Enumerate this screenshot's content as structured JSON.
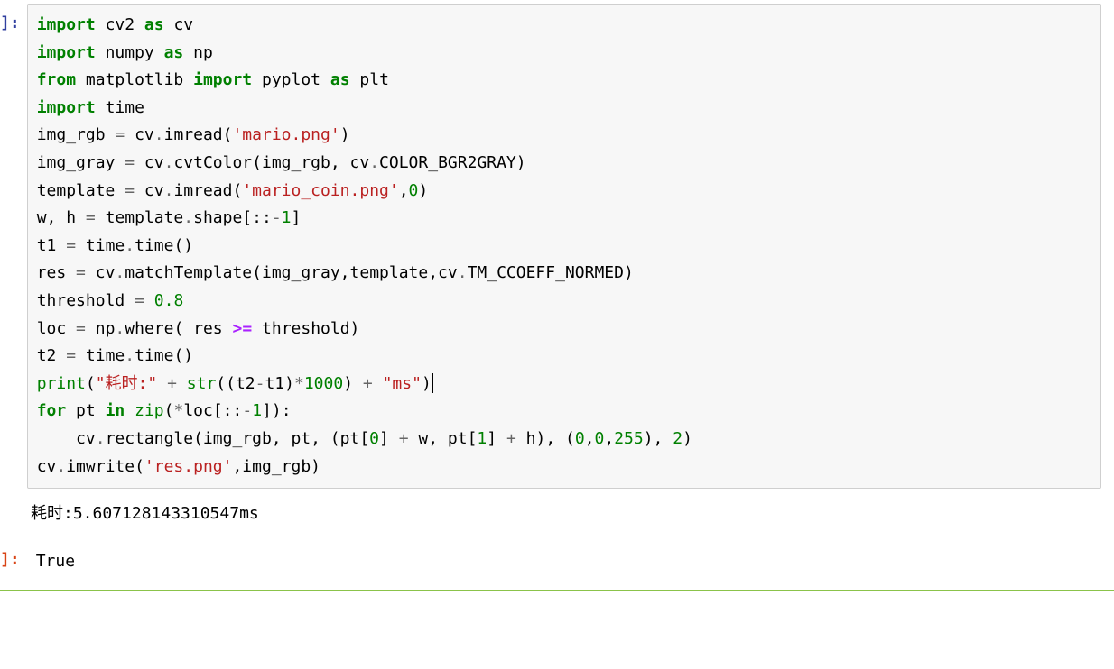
{
  "cell1": {
    "prompt": "]:",
    "code": {
      "l1": {
        "a": "import",
        "b": "cv2",
        "c": "as",
        "d": "cv"
      },
      "l2": {
        "a": "import",
        "b": "numpy",
        "c": "as",
        "d": "np"
      },
      "l3": {
        "a": "from",
        "b": "matplotlib",
        "c": "import",
        "d": "pyplot",
        "e": "as",
        "f": "plt"
      },
      "l4": {
        "a": "import",
        "b": "time"
      },
      "l5": {
        "a": "img_rgb",
        "b": "=",
        "c": "cv",
        "d": ".",
        "e": "imread(",
        "f": "'mario.png'",
        "g": ")"
      },
      "l6": {
        "a": "img_gray",
        "b": "=",
        "c": "cv",
        "d": ".",
        "e": "cvtColor(img_rgb, cv",
        "f": ".",
        "g": "COLOR_BGR2GRAY)"
      },
      "l7": {
        "a": "template",
        "b": "=",
        "c": "cv",
        "d": ".",
        "e": "imread(",
        "f": "'mario_coin.png'",
        "g": ",",
        "h": "0",
        "i": ")"
      },
      "l8": {
        "a": "w, h",
        "b": "=",
        "c": "template",
        "d": ".",
        "e": "shape[::",
        "f": "-",
        "g": "1",
        "h": "]"
      },
      "l9": {
        "a": "t1",
        "b": "=",
        "c": "time",
        "d": ".",
        "e": "time()"
      },
      "l10": {
        "a": "res",
        "b": "=",
        "c": "cv",
        "d": ".",
        "e": "matchTemplate(img_gray,template,cv",
        "f": ".",
        "g": "TM_CCOEFF_NORMED)"
      },
      "l11": {
        "a": "threshold",
        "b": "=",
        "c": "0.8"
      },
      "l12": {
        "a": "loc",
        "b": "=",
        "c": "np",
        "d": ".",
        "e": "where( res",
        "f": ">=",
        "g": "threshold)"
      },
      "l13": {
        "a": "t2",
        "b": "=",
        "c": "time",
        "d": ".",
        "e": "time()"
      },
      "l14": {
        "a": "print",
        "b": "(",
        "c": "\"耗时:\"",
        "d": "+",
        "e": "str",
        "f": "((t2",
        "g": "-",
        "h": "t1)",
        "i": "*",
        "j": "1000",
        "k": ")",
        "l": "+",
        "m": "\"ms\"",
        "n": ")"
      },
      "l15": {
        "a": "for",
        "b": "pt",
        "c": "in",
        "d": "zip",
        "e": "(",
        "f": "*",
        "g": "loc[::",
        "h": "-",
        "i": "1",
        "j": "]):"
      },
      "l16": {
        "a": "    cv",
        "b": ".",
        "c": "rectangle(img_rgb, pt, (pt[",
        "d": "0",
        "e": "]",
        "f": "+",
        "g": "w, pt[",
        "h": "1",
        "i": "]",
        "j": "+",
        "k": "h), (",
        "l": "0",
        "m": ",",
        "n": "0",
        "o": ",",
        "p": "255",
        "q": "),",
        "r": "2",
        "s": ")"
      },
      "l17": {
        "a": "cv",
        "b": ".",
        "c": "imwrite(",
        "d": "'res.png'",
        "e": ",img_rgb)"
      }
    }
  },
  "output_stdout": "耗时:5.607128143310547ms",
  "cell2": {
    "prompt": "]:",
    "result": "True"
  }
}
